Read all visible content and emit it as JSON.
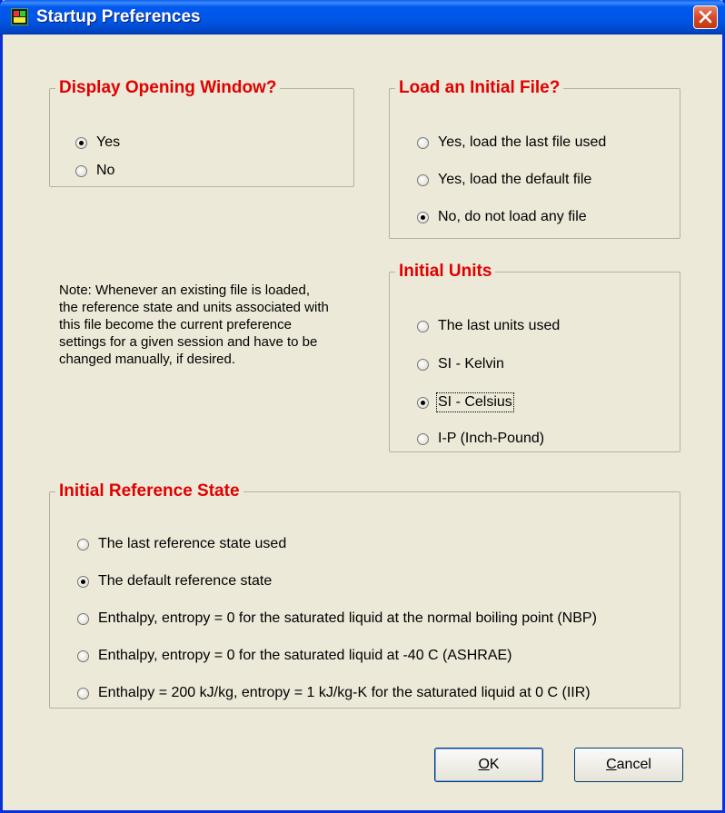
{
  "window": {
    "title": "Startup Preferences"
  },
  "display_opening": {
    "legend": "Display Opening Window?",
    "options": [
      {
        "label": "Yes",
        "checked": true
      },
      {
        "label": "No",
        "checked": false
      }
    ]
  },
  "load_initial": {
    "legend": "Load an Initial File?",
    "options": [
      {
        "label": "Yes, load the last file used",
        "checked": false
      },
      {
        "label": "Yes, load the default file",
        "checked": false
      },
      {
        "label": "No, do not load any file",
        "checked": true
      }
    ]
  },
  "note": "Note: Whenever an existing file is loaded, the reference state and units associated with this file become the current preference settings for a given session and have to be changed manually, if desired.",
  "initial_units": {
    "legend": "Initial Units",
    "options": [
      {
        "label": "The last units used",
        "checked": false
      },
      {
        "label": "SI - Kelvin",
        "checked": false
      },
      {
        "label": "SI - Celsius",
        "checked": true
      },
      {
        "label": "I-P (Inch-Pound)",
        "checked": false
      }
    ]
  },
  "reference_state": {
    "legend": "Initial Reference State",
    "options": [
      {
        "label": "The last reference state used",
        "checked": false
      },
      {
        "label": "The default reference state",
        "checked": true
      },
      {
        "label": "Enthalpy, entropy = 0 for the saturated liquid at the normal boiling point (NBP)",
        "checked": false
      },
      {
        "label": "Enthalpy, entropy = 0 for the saturated liquid at -40 C (ASHRAE)",
        "checked": false
      },
      {
        "label": "Enthalpy = 200 kJ/kg, entropy = 1 kJ/kg-K for the saturated liquid at 0 C (IIR)",
        "checked": false
      }
    ]
  },
  "buttons": {
    "ok": {
      "mnemonic": "O",
      "rest": "K"
    },
    "cancel": {
      "mnemonic": "C",
      "rest": "ancel"
    }
  }
}
